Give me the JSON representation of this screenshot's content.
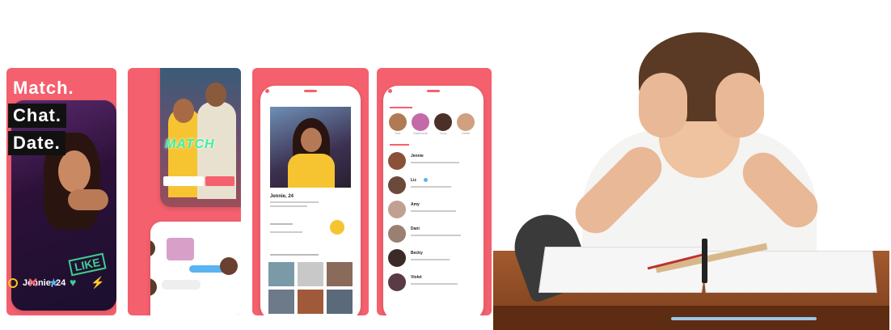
{
  "taglines": [
    "Match.",
    "Chat.",
    "Date."
  ],
  "panel1": {
    "card_name": "Jennie, 24",
    "like_stamp": "LIKE"
  },
  "panel2": {
    "match_title": "MATCH",
    "chat_placeholder": "",
    "chat_bubble": ""
  },
  "panel3": {
    "profile_name": "Jennie, 24",
    "section_about": "",
    "section_photos": ""
  },
  "panel4": {
    "new_matches": [
      "Zoe",
      "Stephanie",
      "Lucy",
      "Claire"
    ],
    "conversations": [
      "Jennie",
      "Liz",
      "Amy",
      "Dani",
      "Becky",
      "Violet"
    ]
  },
  "photo": {
    "description": ""
  },
  "colors": {
    "brand": "#f4606e",
    "accent_green": "#3ecf8e",
    "accent_blue": "#5ab4f0",
    "yellow": "#f5c518"
  },
  "icons": [
    "close-icon",
    "heart-icon",
    "star-icon",
    "lightning-icon",
    "rewind-icon",
    "message-icon",
    "flame-icon"
  ]
}
